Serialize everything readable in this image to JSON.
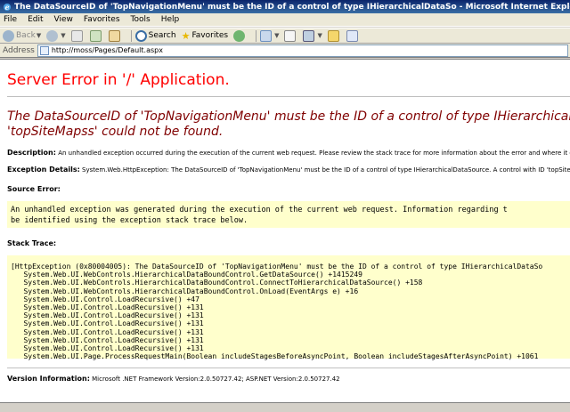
{
  "window": {
    "title": "The DataSourceID of 'TopNavigationMenu' must be the ID of a control of type IHierarchicalDataSo - Microsoft Internet Explorer"
  },
  "menu": {
    "items": [
      "File",
      "Edit",
      "View",
      "Favorites",
      "Tools",
      "Help"
    ]
  },
  "toolbar": {
    "back_label": "Back",
    "search_label": "Search",
    "favorites_label": "Favorites"
  },
  "address": {
    "label": "Address",
    "url": "http://moss/Pages/Default.aspx"
  },
  "page": {
    "heading": "Server Error in '/' Application.",
    "error_line1": "The DataSourceID of 'TopNavigationMenu' must be the ID of a control of type IHierarchical",
    "error_line2": "'topSiteMapss' could not be found.",
    "description_label": "Description:",
    "description_text": "An unhandled exception occurred during the execution of the current web request. Please review the stack trace for more information about the error and where it o",
    "exception_label": "Exception Details:",
    "exception_text": "System.Web.HttpException: The DataSourceID of 'TopNavigationMenu' must be the ID of a control of type IHierarchicalDataSource.  A control with ID 'topSiteM",
    "source_error_label": "Source Error:",
    "source_error_text": "An unhandled exception was generated during the execution of the current web request. Information regarding t\nbe identified using the exception stack trace below.",
    "stack_trace_label": "Stack Trace:",
    "stack_trace_text": "[HttpException (0x80004005): The DataSourceID of 'TopNavigationMenu' must be the ID of a control of type IHierarchicalDataSo\n   System.Web.UI.WebControls.HierarchicalDataBoundControl.GetDataSource() +1415249\n   System.Web.UI.WebControls.HierarchicalDataBoundControl.ConnectToHierarchicalDataSource() +158\n   System.Web.UI.WebControls.HierarchicalDataBoundControl.OnLoad(EventArgs e) +16\n   System.Web.UI.Control.LoadRecursive() +47\n   System.Web.UI.Control.LoadRecursive() +131\n   System.Web.UI.Control.LoadRecursive() +131\n   System.Web.UI.Control.LoadRecursive() +131\n   System.Web.UI.Control.LoadRecursive() +131\n   System.Web.UI.Control.LoadRecursive() +131\n   System.Web.UI.Control.LoadRecursive() +131\n   System.Web.UI.Page.ProcessRequestMain(Boolean includeStagesBeforeAsyncPoint, Boolean includeStagesAfterAsyncPoint) +1061",
    "version_label": "Version Information:",
    "version_text": "Microsoft .NET Framework Version:2.0.50727.42; ASP.NET Version:2.0.50727.42"
  },
  "colors": {
    "heading_red": "#ff0000",
    "error_maroon": "#800000",
    "code_bg": "#ffffcc",
    "titlebar": "#0a246a"
  }
}
